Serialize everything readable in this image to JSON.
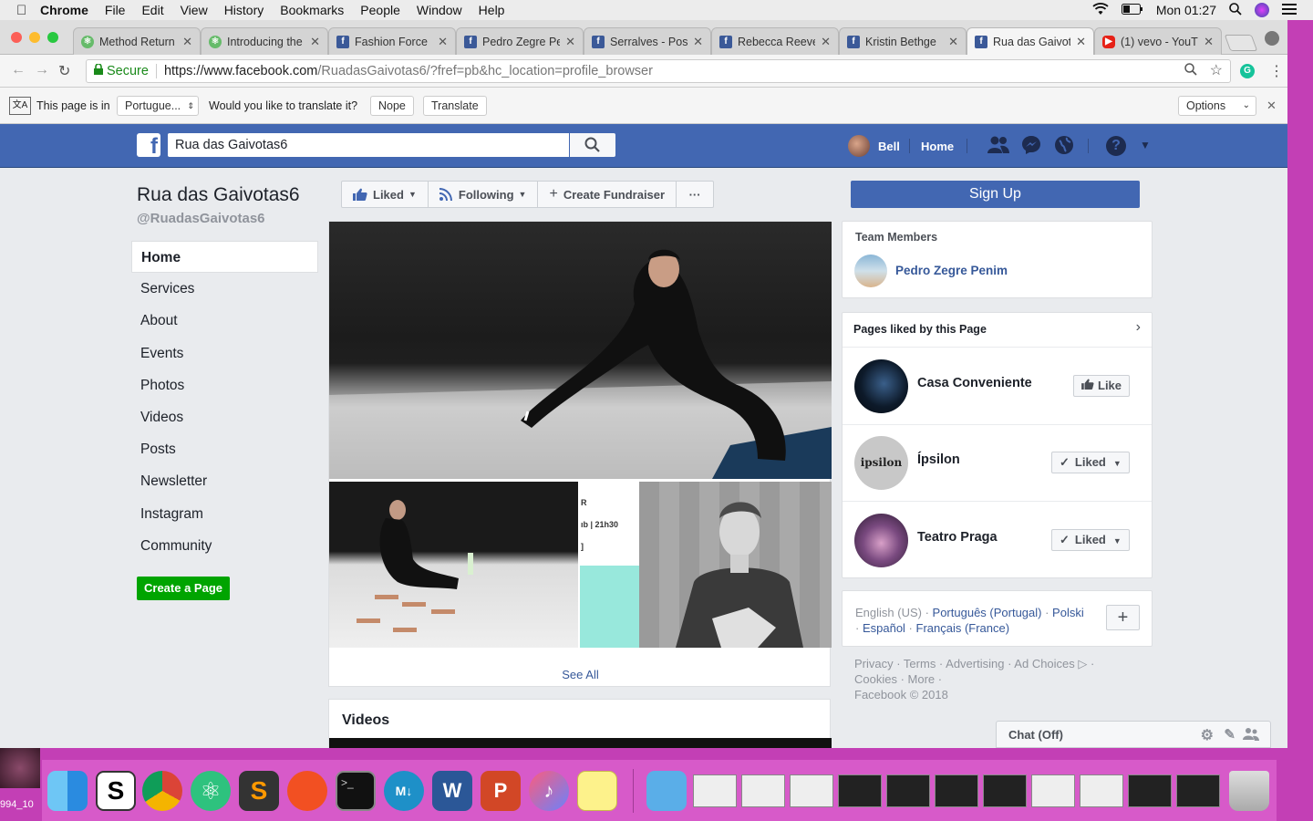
{
  "menubar": {
    "items": [
      "Chrome",
      "File",
      "Edit",
      "View",
      "History",
      "Bookmarks",
      "People",
      "Window",
      "Help"
    ],
    "clock": "Mon 01:27"
  },
  "tabs": [
    {
      "label": "Method Return",
      "fav": "atom"
    },
    {
      "label": "Introducing the",
      "fav": "atom"
    },
    {
      "label": "Fashion Force",
      "fav": "fb"
    },
    {
      "label": "Pedro Zegre Pe",
      "fav": "fb"
    },
    {
      "label": "Serralves - Pos",
      "fav": "fb"
    },
    {
      "label": "Rebecca Reeve",
      "fav": "fb"
    },
    {
      "label": "Kristin Bethge",
      "fav": "fb"
    },
    {
      "label": "Rua das Gaivot",
      "fav": "fb"
    },
    {
      "label": "(1) vevo - YouT",
      "fav": "yt"
    }
  ],
  "omnibox": {
    "secure": "Secure",
    "url_main": "https://www.facebook.com",
    "url_rest": "/RuadasGaivotas6/?fref=pb&hc_location=profile_browser"
  },
  "translate": {
    "prefix": "This page is in",
    "language": "Portugue...",
    "question": "Would you like to translate it?",
    "nope": "Nope",
    "translate": "Translate",
    "options": "Options"
  },
  "fb": {
    "search_value": "Rua das Gaivotas6",
    "user": "Bell",
    "home": "Home"
  },
  "page": {
    "name": "Rua das Gaivotas6",
    "handle": "@RuadasGaivotas6",
    "nav": [
      "Home",
      "Services",
      "About",
      "Events",
      "Photos",
      "Videos",
      "Posts",
      "Newsletter",
      "Instagram",
      "Community"
    ],
    "create_page": "Create a Page"
  },
  "actions": {
    "liked": "Liked",
    "following": "Following",
    "fundraiser": "Create Fundraiser",
    "more": "···"
  },
  "photos": {
    "poster_lines": [
      "R",
      "ıb | 21h30",
      "]"
    ],
    "see_all": "See All"
  },
  "videos": {
    "title": "Videos"
  },
  "right": {
    "sign_up": "Sign Up",
    "team_title": "Team Members",
    "team_member": "Pedro Zegre Penim",
    "liked_title": "Pages liked by this Page",
    "liked_pages": [
      {
        "name": "Casa Conveniente",
        "button": "Like"
      },
      {
        "name": "Ípsilon",
        "button": "Liked",
        "avatar_text": "ipsilon"
      },
      {
        "name": "Teatro Praga",
        "button": "Liked"
      }
    ],
    "languages": {
      "current": "English (US)",
      "l1": "Português (Portugal)",
      "l2": "Polski",
      "l3": "Español",
      "l4": "Français (France)"
    },
    "footer_line1": "Privacy · Terms · Advertising · Ad Choices ▷ ·",
    "footer_line2": "Cookies · More ·",
    "footer_line3": "Facebook © 2018"
  },
  "chat": {
    "label": "Chat (Off)"
  },
  "desktop": {
    "file_label": "994_10"
  },
  "colors": {
    "fb_blue": "#4267b2",
    "green": "#00a400",
    "link": "#365899"
  }
}
